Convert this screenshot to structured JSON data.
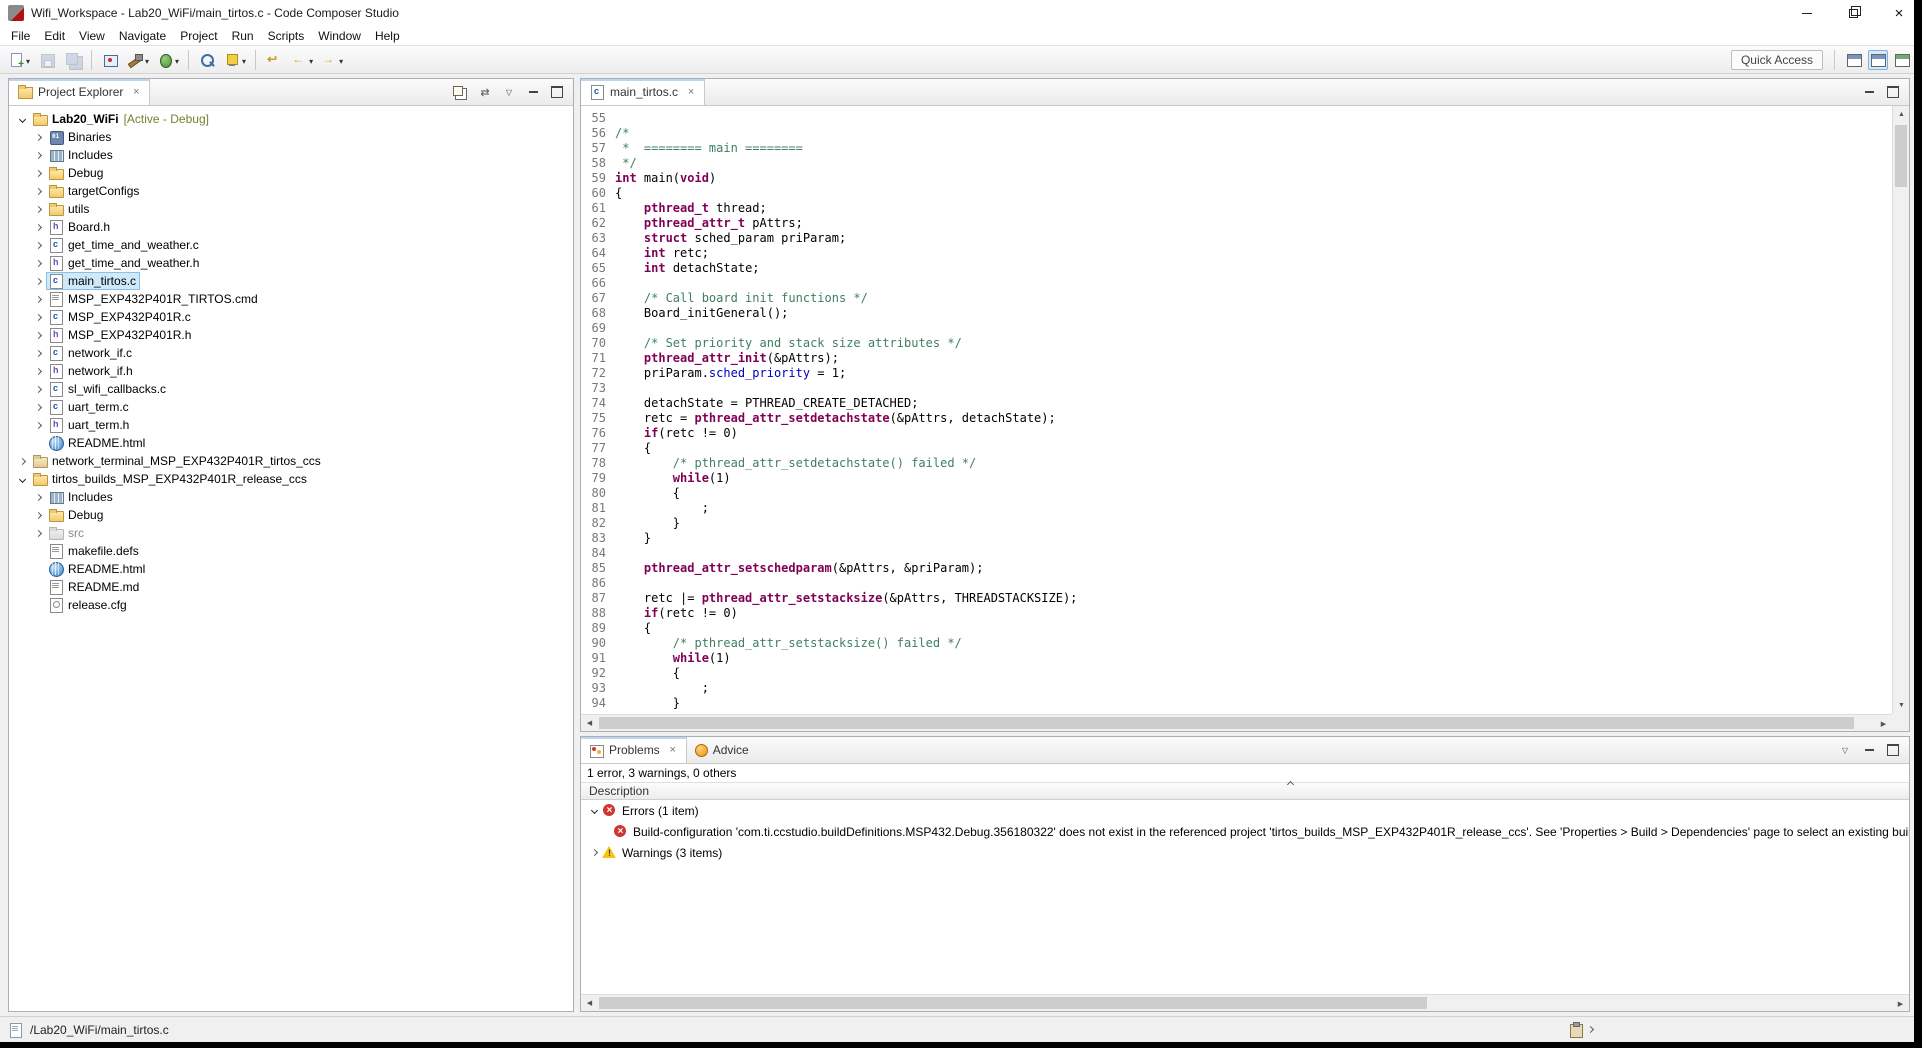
{
  "window": {
    "title": "Wifi_Workspace - Lab20_WiFi/main_tirtos.c - Code Composer Studio"
  },
  "menu_bar": {
    "items": [
      "File",
      "Edit",
      "View",
      "Navigate",
      "Project",
      "Run",
      "Scripts",
      "Window",
      "Help"
    ]
  },
  "toolbar": {
    "quick_access": "Quick Access",
    "buttons": [
      {
        "id": "new",
        "icon": "new-doc",
        "dropdown": true
      },
      {
        "id": "save",
        "icon": "save",
        "disabled": true
      },
      {
        "id": "save-all",
        "icon": "save-all",
        "disabled": true
      },
      {
        "sep": true
      },
      {
        "id": "new-target-configuration",
        "icon": "target"
      },
      {
        "id": "build",
        "icon": "hammer",
        "dropdown": true
      },
      {
        "id": "debug",
        "icon": "bug",
        "dropdown": true
      },
      {
        "sep": true
      },
      {
        "id": "search",
        "icon": "search"
      },
      {
        "id": "mark-occurrences",
        "icon": "marker",
        "dropdown": true
      },
      {
        "sep": true
      },
      {
        "id": "last-edit-location",
        "icon": "back-curve"
      },
      {
        "id": "back",
        "icon": "arrow-left",
        "dropdown": true
      },
      {
        "id": "forward",
        "icon": "arrow-right",
        "dropdown": true
      }
    ]
  },
  "project_explorer": {
    "title": "Project Explorer",
    "items": [
      {
        "label": "Lab20_WiFi",
        "suffix": "[Active - Debug]",
        "depth": 0,
        "icon": "project",
        "arrow": "expanded",
        "bold": true
      },
      {
        "label": "Binaries",
        "depth": 1,
        "icon": "binaries",
        "arrow": "collapsed"
      },
      {
        "label": "Includes",
        "depth": 1,
        "icon": "includes",
        "arrow": "collapsed"
      },
      {
        "label": "Debug",
        "depth": 1,
        "icon": "folder",
        "arrow": "collapsed"
      },
      {
        "label": "targetConfigs",
        "depth": 1,
        "icon": "folder",
        "arrow": "collapsed"
      },
      {
        "label": "utils",
        "depth": 1,
        "icon": "folder",
        "arrow": "collapsed"
      },
      {
        "label": "Board.h",
        "depth": 1,
        "icon": "h-file",
        "arrow": "collapsed"
      },
      {
        "label": "get_time_and_weather.c",
        "depth": 1,
        "icon": "c-file",
        "arrow": "collapsed"
      },
      {
        "label": "get_time_and_weather.h",
        "depth": 1,
        "icon": "h-file",
        "arrow": "collapsed"
      },
      {
        "label": "main_tirtos.c",
        "depth": 1,
        "icon": "c-file",
        "arrow": "collapsed",
        "selected": true
      },
      {
        "label": "MSP_EXP432P401R_TIRTOS.cmd",
        "depth": 1,
        "icon": "cmd-file",
        "arrow": "collapsed"
      },
      {
        "label": "MSP_EXP432P401R.c",
        "depth": 1,
        "icon": "c-file",
        "arrow": "collapsed"
      },
      {
        "label": "MSP_EXP432P401R.h",
        "depth": 1,
        "icon": "h-file",
        "arrow": "collapsed"
      },
      {
        "label": "network_if.c",
        "depth": 1,
        "icon": "c-file",
        "arrow": "collapsed"
      },
      {
        "label": "network_if.h",
        "depth": 1,
        "icon": "h-file",
        "arrow": "collapsed"
      },
      {
        "label": "sl_wifi_callbacks.c",
        "depth": 1,
        "icon": "c-file",
        "arrow": "collapsed"
      },
      {
        "label": "uart_term.c",
        "depth": 1,
        "icon": "c-file",
        "arrow": "collapsed"
      },
      {
        "label": "uart_term.h",
        "depth": 1,
        "icon": "h-file",
        "arrow": "collapsed"
      },
      {
        "label": "README.html",
        "depth": 1,
        "icon": "html-file",
        "arrow": "none"
      },
      {
        "label": "network_terminal_MSP_EXP432P401R_tirtos_ccs",
        "depth": 0,
        "icon": "project-closed",
        "arrow": "collapsed"
      },
      {
        "label": "tirtos_builds_MSP_EXP432P401R_release_ccs",
        "depth": 0,
        "icon": "project",
        "arrow": "expanded"
      },
      {
        "label": "Includes",
        "depth": 1,
        "icon": "includes",
        "arrow": "collapsed"
      },
      {
        "label": "Debug",
        "depth": 1,
        "icon": "folder",
        "arrow": "collapsed"
      },
      {
        "label": "src",
        "depth": 1,
        "icon": "folder-dim",
        "arrow": "collapsed",
        "dim": true
      },
      {
        "label": "makefile.defs",
        "depth": 1,
        "icon": "text-file",
        "arrow": "none"
      },
      {
        "label": "README.html",
        "depth": 1,
        "icon": "html-file",
        "arrow": "none"
      },
      {
        "label": "README.md",
        "depth": 1,
        "icon": "text-file",
        "arrow": "none"
      },
      {
        "label": "release.cfg",
        "depth": 1,
        "icon": "cfg-file",
        "arrow": "none"
      }
    ]
  },
  "editor": {
    "tab_label": "main_tirtos.c",
    "lines": [
      {
        "n": 55,
        "s": []
      },
      {
        "n": 56,
        "s": [
          [
            "c",
            "/*"
          ]
        ]
      },
      {
        "n": 57,
        "s": [
          [
            "c",
            " *  ======== main ========"
          ]
        ]
      },
      {
        "n": 58,
        "s": [
          [
            "c",
            " */"
          ]
        ]
      },
      {
        "n": 59,
        "s": [
          [
            "k",
            "int"
          ],
          [
            "p",
            " main("
          ],
          [
            "k",
            "void"
          ],
          [
            "p",
            ")"
          ]
        ]
      },
      {
        "n": 60,
        "s": [
          [
            "p",
            "{"
          ]
        ]
      },
      {
        "n": 61,
        "s": [
          [
            "p",
            "    "
          ],
          [
            "t",
            "pthread_t"
          ],
          [
            "p",
            " thread;"
          ]
        ]
      },
      {
        "n": 62,
        "s": [
          [
            "p",
            "    "
          ],
          [
            "t",
            "pthread_attr_t"
          ],
          [
            "p",
            " pAttrs;"
          ]
        ]
      },
      {
        "n": 63,
        "s": [
          [
            "p",
            "    "
          ],
          [
            "k",
            "struct"
          ],
          [
            "p",
            " sched_param priParam;"
          ]
        ]
      },
      {
        "n": 64,
        "s": [
          [
            "p",
            "    "
          ],
          [
            "k",
            "int"
          ],
          [
            "p",
            " retc;"
          ]
        ]
      },
      {
        "n": 65,
        "s": [
          [
            "p",
            "    "
          ],
          [
            "k",
            "int"
          ],
          [
            "p",
            " detachState;"
          ]
        ]
      },
      {
        "n": 66,
        "s": []
      },
      {
        "n": 67,
        "s": [
          [
            "p",
            "    "
          ],
          [
            "c",
            "/* Call board init functions */"
          ]
        ]
      },
      {
        "n": 68,
        "s": [
          [
            "p",
            "    Board_initGeneral();"
          ]
        ]
      },
      {
        "n": 69,
        "s": []
      },
      {
        "n": 70,
        "s": [
          [
            "p",
            "    "
          ],
          [
            "c",
            "/* Set priority and stack size attributes */"
          ]
        ]
      },
      {
        "n": 71,
        "s": [
          [
            "p",
            "    "
          ],
          [
            "t",
            "pthread_attr_init"
          ],
          [
            "p",
            "(&pAttrs);"
          ]
        ]
      },
      {
        "n": 72,
        "s": [
          [
            "p",
            "    priParam."
          ],
          [
            "f",
            "sched_priority"
          ],
          [
            "p",
            " = 1;"
          ]
        ]
      },
      {
        "n": 73,
        "s": []
      },
      {
        "n": 74,
        "s": [
          [
            "p",
            "    detachState = PTHREAD_CREATE_DETACHED;"
          ]
        ]
      },
      {
        "n": 75,
        "s": [
          [
            "p",
            "    retc = "
          ],
          [
            "t",
            "pthread_attr_setdetachstate"
          ],
          [
            "p",
            "(&pAttrs, detachState);"
          ]
        ]
      },
      {
        "n": 76,
        "s": [
          [
            "p",
            "    "
          ],
          [
            "k",
            "if"
          ],
          [
            "p",
            "(retc != 0)"
          ]
        ]
      },
      {
        "n": 77,
        "s": [
          [
            "p",
            "    {"
          ]
        ]
      },
      {
        "n": 78,
        "s": [
          [
            "p",
            "        "
          ],
          [
            "c",
            "/* pthread_attr_setdetachstate() failed */"
          ]
        ]
      },
      {
        "n": 79,
        "s": [
          [
            "p",
            "        "
          ],
          [
            "k",
            "while"
          ],
          [
            "p",
            "(1)"
          ]
        ]
      },
      {
        "n": 80,
        "s": [
          [
            "p",
            "        {"
          ]
        ]
      },
      {
        "n": 81,
        "s": [
          [
            "p",
            "            ;"
          ]
        ]
      },
      {
        "n": 82,
        "s": [
          [
            "p",
            "        }"
          ]
        ]
      },
      {
        "n": 83,
        "s": [
          [
            "p",
            "    }"
          ]
        ]
      },
      {
        "n": 84,
        "s": []
      },
      {
        "n": 85,
        "s": [
          [
            "p",
            "    "
          ],
          [
            "t",
            "pthread_attr_setschedparam"
          ],
          [
            "p",
            "(&pAttrs, &priParam);"
          ]
        ]
      },
      {
        "n": 86,
        "s": []
      },
      {
        "n": 87,
        "s": [
          [
            "p",
            "    retc |= "
          ],
          [
            "t",
            "pthread_attr_setstacksize"
          ],
          [
            "p",
            "(&pAttrs, THREADSTACKSIZE);"
          ]
        ]
      },
      {
        "n": 88,
        "s": [
          [
            "p",
            "    "
          ],
          [
            "k",
            "if"
          ],
          [
            "p",
            "(retc != 0)"
          ]
        ]
      },
      {
        "n": 89,
        "s": [
          [
            "p",
            "    {"
          ]
        ]
      },
      {
        "n": 90,
        "s": [
          [
            "p",
            "        "
          ],
          [
            "c",
            "/* pthread_attr_setstacksize() failed */"
          ]
        ]
      },
      {
        "n": 91,
        "s": [
          [
            "p",
            "        "
          ],
          [
            "k",
            "while"
          ],
          [
            "p",
            "(1)"
          ]
        ]
      },
      {
        "n": 92,
        "s": [
          [
            "p",
            "        {"
          ]
        ]
      },
      {
        "n": 93,
        "s": [
          [
            "p",
            "            ;"
          ]
        ]
      },
      {
        "n": 94,
        "s": [
          [
            "p",
            "        }"
          ]
        ]
      }
    ]
  },
  "problems": {
    "tabs": [
      {
        "label": "Problems",
        "active": true
      },
      {
        "label": "Advice",
        "active": false
      }
    ],
    "summary": "1 error, 3 warnings, 0 others",
    "column_header": "Description",
    "rows": [
      {
        "type": "group",
        "icon": "error",
        "arrow": "expanded",
        "label": "Errors (1 item)"
      },
      {
        "type": "item",
        "icon": "error",
        "label": "Build-configuration 'com.ti.ccstudio.buildDefinitions.MSP432.Debug.356180322' does not exist in the referenced project 'tirtos_builds_MSP_EXP432P401R_release_ccs'. See 'Properties > Build > Dependencies' page to select an existing build-configuration."
      },
      {
        "type": "group",
        "icon": "warning",
        "arrow": "collapsed",
        "label": "Warnings (3 items)"
      }
    ]
  },
  "status_bar": {
    "path": "/Lab20_WiFi/main_tirtos.c"
  },
  "colors": {
    "keyword": "#7f0055",
    "comment": "#3f7f5f",
    "field": "#0000c0",
    "selection": "#cfe8fa",
    "active_config_suffix": "#77812f",
    "error": "#cf3732",
    "warning": "#f5c518"
  }
}
